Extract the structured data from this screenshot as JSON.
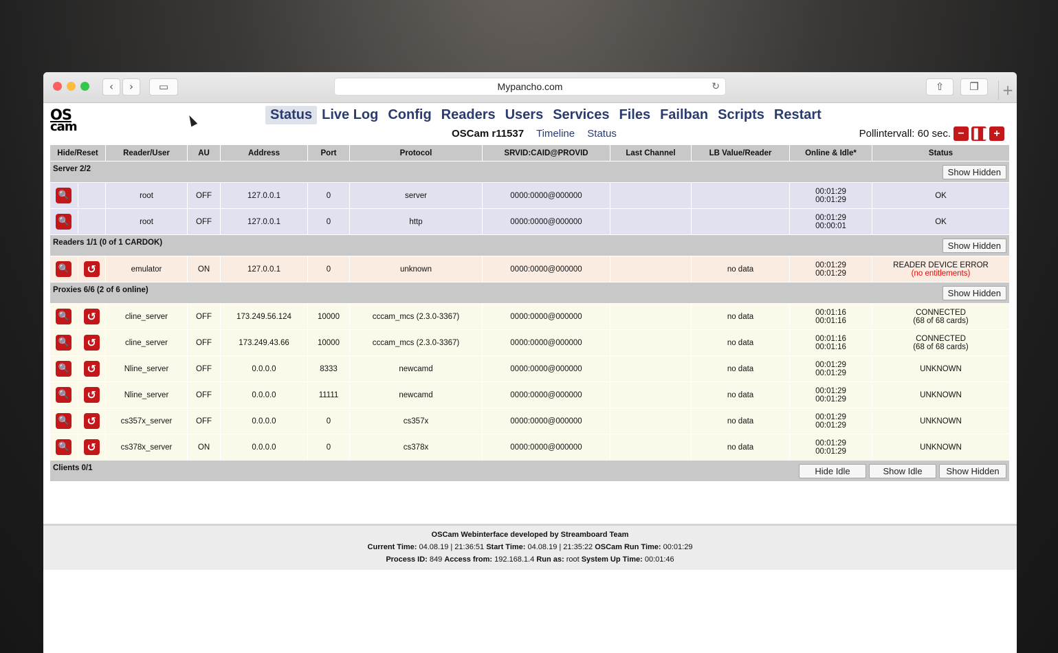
{
  "browser": {
    "url": "Mypancho.com"
  },
  "app": {
    "logo_top": "OS",
    "logo_bottom": "cam",
    "menu": [
      "Status",
      "Live Log",
      "Config",
      "Readers",
      "Users",
      "Services",
      "Files",
      "Failban",
      "Scripts",
      "Restart"
    ],
    "active_menu": "Status",
    "version": "OSCam r11537",
    "sub_links": [
      "Timeline",
      "Status"
    ],
    "poll_label": "Pollintervall: 60 sec."
  },
  "table": {
    "headers": [
      "Hide/Reset",
      "Reader/User",
      "AU",
      "Address",
      "Port",
      "Protocol",
      "SRVID:CAID@PROVID",
      "Last Channel",
      "LB Value/Reader",
      "Online & Idle*",
      "Status"
    ],
    "sections": {
      "server": {
        "title": "Server 2/2",
        "buttons": [
          "Show Hidden"
        ]
      },
      "readers": {
        "title": "Readers 1/1 (0 of 1 CARDOK)",
        "buttons": [
          "Show Hidden"
        ]
      },
      "proxies": {
        "title": "Proxies 6/6 (2 of 6 online)",
        "buttons": [
          "Show Hidden"
        ]
      },
      "clients": {
        "title": "Clients 0/1",
        "buttons": [
          "Hide Idle",
          "Show Idle",
          "Show Hidden"
        ]
      }
    },
    "server_rows": [
      {
        "name": "root",
        "au": "OFF",
        "address": "127.0.0.1",
        "port": "0",
        "protocol": "server",
        "srvid": "0000:0000@000000",
        "last_channel": "",
        "lb": "",
        "online": "00:01:29",
        "idle": "00:01:29",
        "status": "OK",
        "status2": ""
      },
      {
        "name": "root",
        "au": "OFF",
        "address": "127.0.0.1",
        "port": "0",
        "protocol": "http",
        "srvid": "0000:0000@000000",
        "last_channel": "",
        "lb": "",
        "online": "00:01:29",
        "idle": "00:00:01",
        "status": "OK",
        "status2": ""
      }
    ],
    "reader_rows": [
      {
        "name": "emulator",
        "au": "ON",
        "address": "127.0.0.1",
        "port": "0",
        "protocol": "unknown",
        "srvid": "0000:0000@000000",
        "last_channel": "",
        "lb": "no data",
        "online": "00:01:29",
        "idle": "00:01:29",
        "status": "READER DEVICE ERROR",
        "status2": "(no entitlements)"
      }
    ],
    "proxy_rows": [
      {
        "name": "cline_server",
        "au": "OFF",
        "address": "173.249.56.124",
        "port": "10000",
        "protocol": "cccam_mcs (2.3.0-3367)",
        "srvid": "0000:0000@000000",
        "last_channel": "",
        "lb": "no data",
        "online": "00:01:16",
        "idle": "00:01:16",
        "status": "CONNECTED",
        "status2": "(68 of 68 cards)"
      },
      {
        "name": "cline_server",
        "au": "OFF",
        "address": "173.249.43.66",
        "port": "10000",
        "protocol": "cccam_mcs (2.3.0-3367)",
        "srvid": "0000:0000@000000",
        "last_channel": "",
        "lb": "no data",
        "online": "00:01:16",
        "idle": "00:01:16",
        "status": "CONNECTED",
        "status2": "(68 of 68 cards)"
      },
      {
        "name": "Nline_server",
        "au": "OFF",
        "address": "0.0.0.0",
        "port": "8333",
        "protocol": "newcamd",
        "srvid": "0000:0000@000000",
        "last_channel": "",
        "lb": "no data",
        "online": "00:01:29",
        "idle": "00:01:29",
        "status": "UNKNOWN",
        "status2": ""
      },
      {
        "name": "Nline_server",
        "au": "OFF",
        "address": "0.0.0.0",
        "port": "11111",
        "protocol": "newcamd",
        "srvid": "0000:0000@000000",
        "last_channel": "",
        "lb": "no data",
        "online": "00:01:29",
        "idle": "00:01:29",
        "status": "UNKNOWN",
        "status2": ""
      },
      {
        "name": "cs357x_server",
        "au": "OFF",
        "address": "0.0.0.0",
        "port": "0",
        "protocol": "cs357x",
        "srvid": "0000:0000@000000",
        "last_channel": "",
        "lb": "no data",
        "online": "00:01:29",
        "idle": "00:01:29",
        "status": "UNKNOWN",
        "status2": ""
      },
      {
        "name": "cs378x_server",
        "au": "ON",
        "address": "0.0.0.0",
        "port": "0",
        "protocol": "cs378x",
        "srvid": "0000:0000@000000",
        "last_channel": "",
        "lb": "no data",
        "online": "00:01:29",
        "idle": "00:01:29",
        "status": "UNKNOWN",
        "status2": ""
      }
    ]
  },
  "footer": {
    "line1": "OSCam Webinterface developed by Streamboard Team",
    "current_time_label": "Current Time:",
    "current_time": "04.08.19 | 21:36:51",
    "start_time_label": "Start Time:",
    "start_time": "04.08.19 | 21:35:22",
    "run_time_label": "OSCam Run Time:",
    "run_time": "00:01:29",
    "pid_label": "Process ID:",
    "pid": "849",
    "access_label": "Access from:",
    "access": "192.168.1.4",
    "runas_label": "Run as:",
    "runas": "root",
    "uptime_label": "System Up Time:",
    "uptime": "00:01:46"
  },
  "colors": {
    "accent": "#c3171a",
    "menu_text": "#2a3b6e",
    "error_text": "#ee0000",
    "server_row": "#e1e1ef",
    "reader_row": "#fbece1",
    "proxy_row": "#fbfaea"
  },
  "icons": {
    "zoom": "magnifier-icon",
    "reset": "reset-arrow-icon"
  }
}
